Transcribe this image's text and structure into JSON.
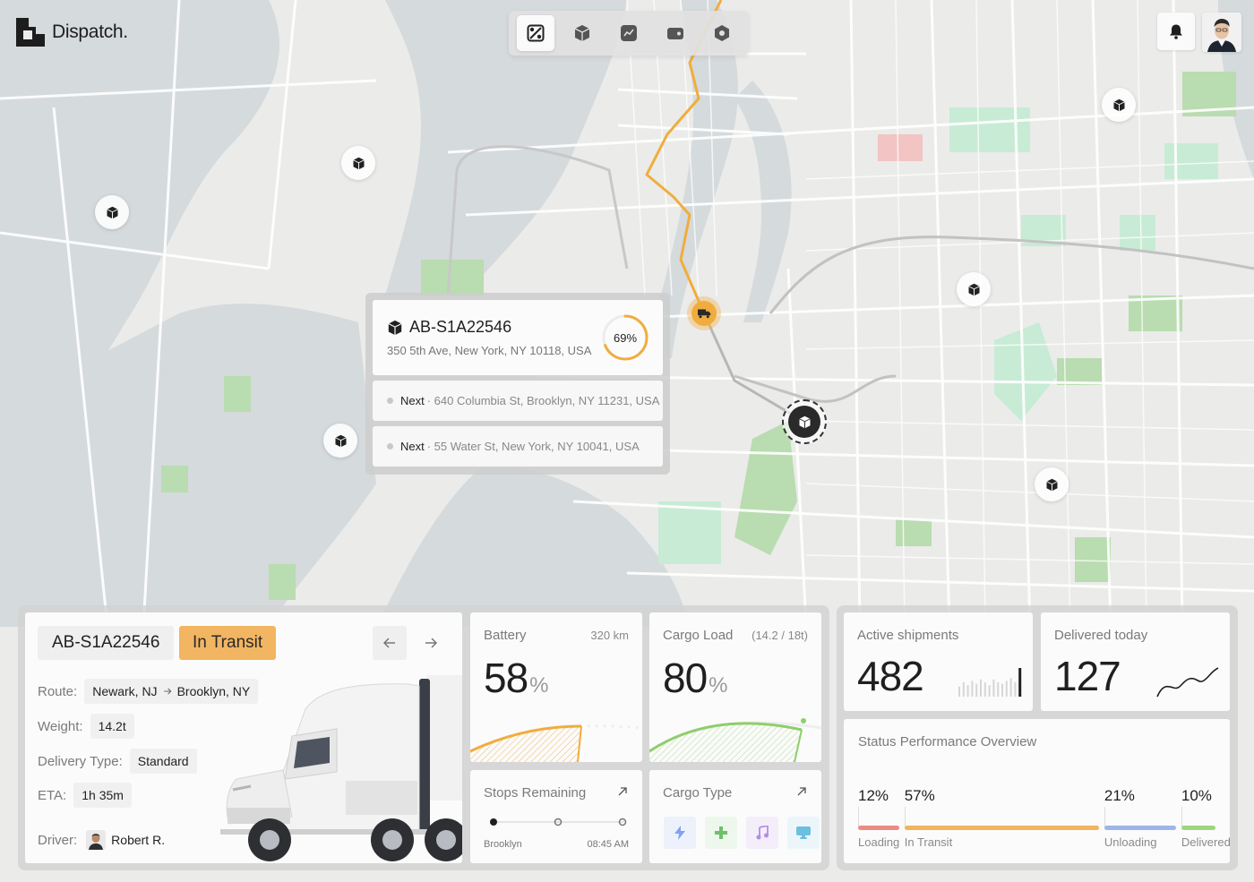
{
  "app": {
    "name": "Dispatch."
  },
  "toolbar": {
    "items": [
      {
        "icon": "map-route-icon",
        "active": true
      },
      {
        "icon": "package-icon",
        "active": false
      },
      {
        "icon": "analytics-icon",
        "active": false
      },
      {
        "icon": "wallet-icon",
        "active": false
      },
      {
        "icon": "settings-hex-icon",
        "active": false
      }
    ]
  },
  "header": {
    "notifications_icon": "bell-icon",
    "avatar_icon": "user-avatar"
  },
  "shipment_popup": {
    "id": "AB-S1A22546",
    "address": "350 5th Ave, New York, NY 10118, USA",
    "progress_label": "69%",
    "progress": 0.69,
    "next_stops": [
      {
        "prefix": "Next",
        "address": "· 640 Columbia St, Brooklyn, NY 11231, USA"
      },
      {
        "prefix": "Next",
        "address": "· 55 Water St, New York, NY 10041, USA"
      }
    ]
  },
  "vehicle": {
    "id": "AB-S1A22546",
    "status": "In Transit",
    "route_label": "Route:",
    "route_from": "Newark, NJ",
    "route_to": "Brooklyn, NY",
    "weight_label": "Weight:",
    "weight": "14.2t",
    "delivery_type_label": "Delivery Type:",
    "delivery_type": "Standard",
    "eta_label": "ETA:",
    "eta": "1h 35m",
    "driver_label": "Driver:",
    "driver": "Robert R."
  },
  "battery": {
    "label": "Battery",
    "range": "320 km",
    "value": "58",
    "unit": "%",
    "fill": 0.58,
    "color": "#f0ad3d"
  },
  "cargo_load": {
    "label": "Cargo Load",
    "capacity": "(14.2 / 18t)",
    "value": "80",
    "unit": "%",
    "fill": 0.8,
    "color": "#8fce6b"
  },
  "stops": {
    "label": "Stops Remaining",
    "from": "Brooklyn",
    "time": "08:45 AM"
  },
  "cargo_type": {
    "label": "Cargo Type",
    "types": [
      {
        "icon": "lightning-icon",
        "color": "#7fa3f0"
      },
      {
        "icon": "medical-cross-icon",
        "color": "#6fc06a"
      },
      {
        "icon": "music-note-icon",
        "color": "#b58be6"
      },
      {
        "icon": "monitor-icon",
        "color": "#6dbfe0"
      }
    ]
  },
  "active_shipments": {
    "label": "Active shipments",
    "value": "482",
    "bars": [
      0.35,
      0.5,
      0.4,
      0.55,
      0.45,
      0.6,
      0.5,
      0.4,
      0.6,
      0.5,
      0.45,
      0.55,
      0.65,
      0.5,
      1.0
    ]
  },
  "delivered_today": {
    "label": "Delivered today",
    "value": "127"
  },
  "status_performance": {
    "title": "Status Performance Overview",
    "segments": [
      {
        "pct": "12%",
        "label": "Loading",
        "value": 12,
        "color": "#ea8b86"
      },
      {
        "pct": "57%",
        "label": "In Transit",
        "value": 57,
        "color": "#f0b55e"
      },
      {
        "pct": "21%",
        "label": "Unloading",
        "value": 21,
        "color": "#9db6ea"
      },
      {
        "pct": "10%",
        "label": "Delivered",
        "value": 10,
        "color": "#9fd57e"
      }
    ]
  }
}
